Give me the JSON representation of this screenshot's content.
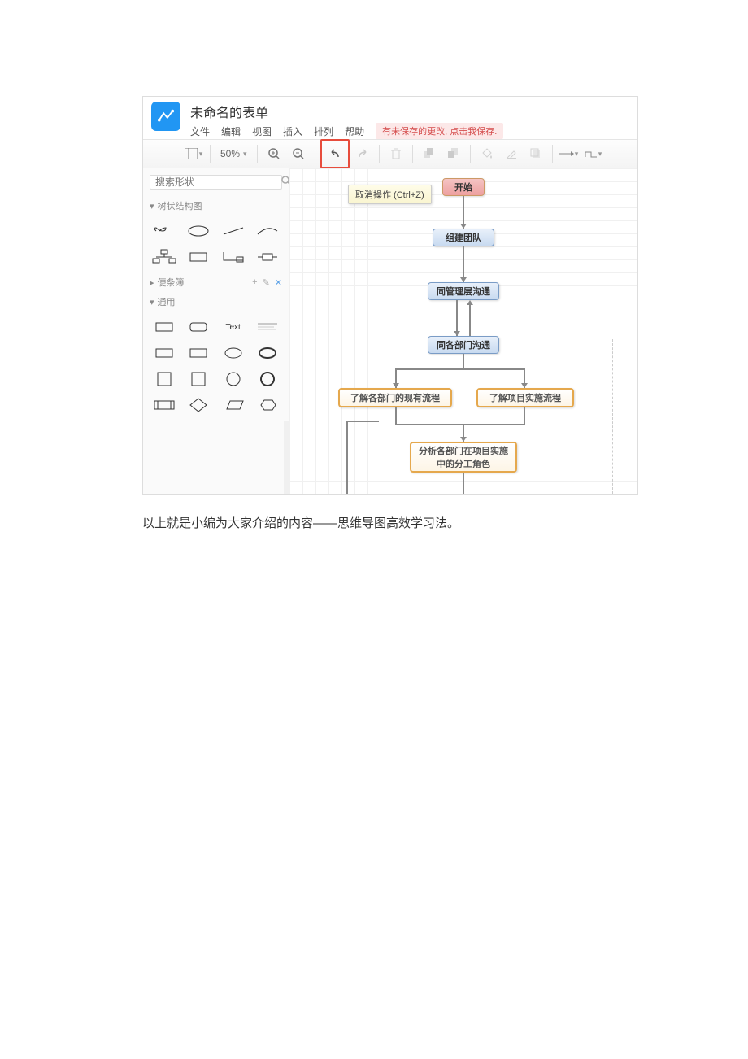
{
  "header": {
    "doc_title": "未命名的表单",
    "menus": [
      "文件",
      "编辑",
      "视图",
      "插入",
      "排列",
      "帮助"
    ],
    "unsaved_notice": "有未保存的更改, 点击我保存."
  },
  "toolbar": {
    "zoom_value": "50%",
    "undo_tooltip": "取消操作 (Ctrl+Z)"
  },
  "sidebar": {
    "search_placeholder": "搜索形状",
    "panel_tree": "树状结构图",
    "panel_notes": "便条簿",
    "panel_general": "通用",
    "text_shape_label": "Text"
  },
  "flowchart": {
    "n1": "开始",
    "n2": "组建团队",
    "n3": "同管理层沟通",
    "n4": "同各部门沟通",
    "n5": "了解各部门的现有流程",
    "n6": "了解项目实施流程",
    "n7": "分析各部门在项目实施中的分工角色"
  },
  "caption": "以上就是小编为大家介绍的内容——思维导图高效学习法。"
}
